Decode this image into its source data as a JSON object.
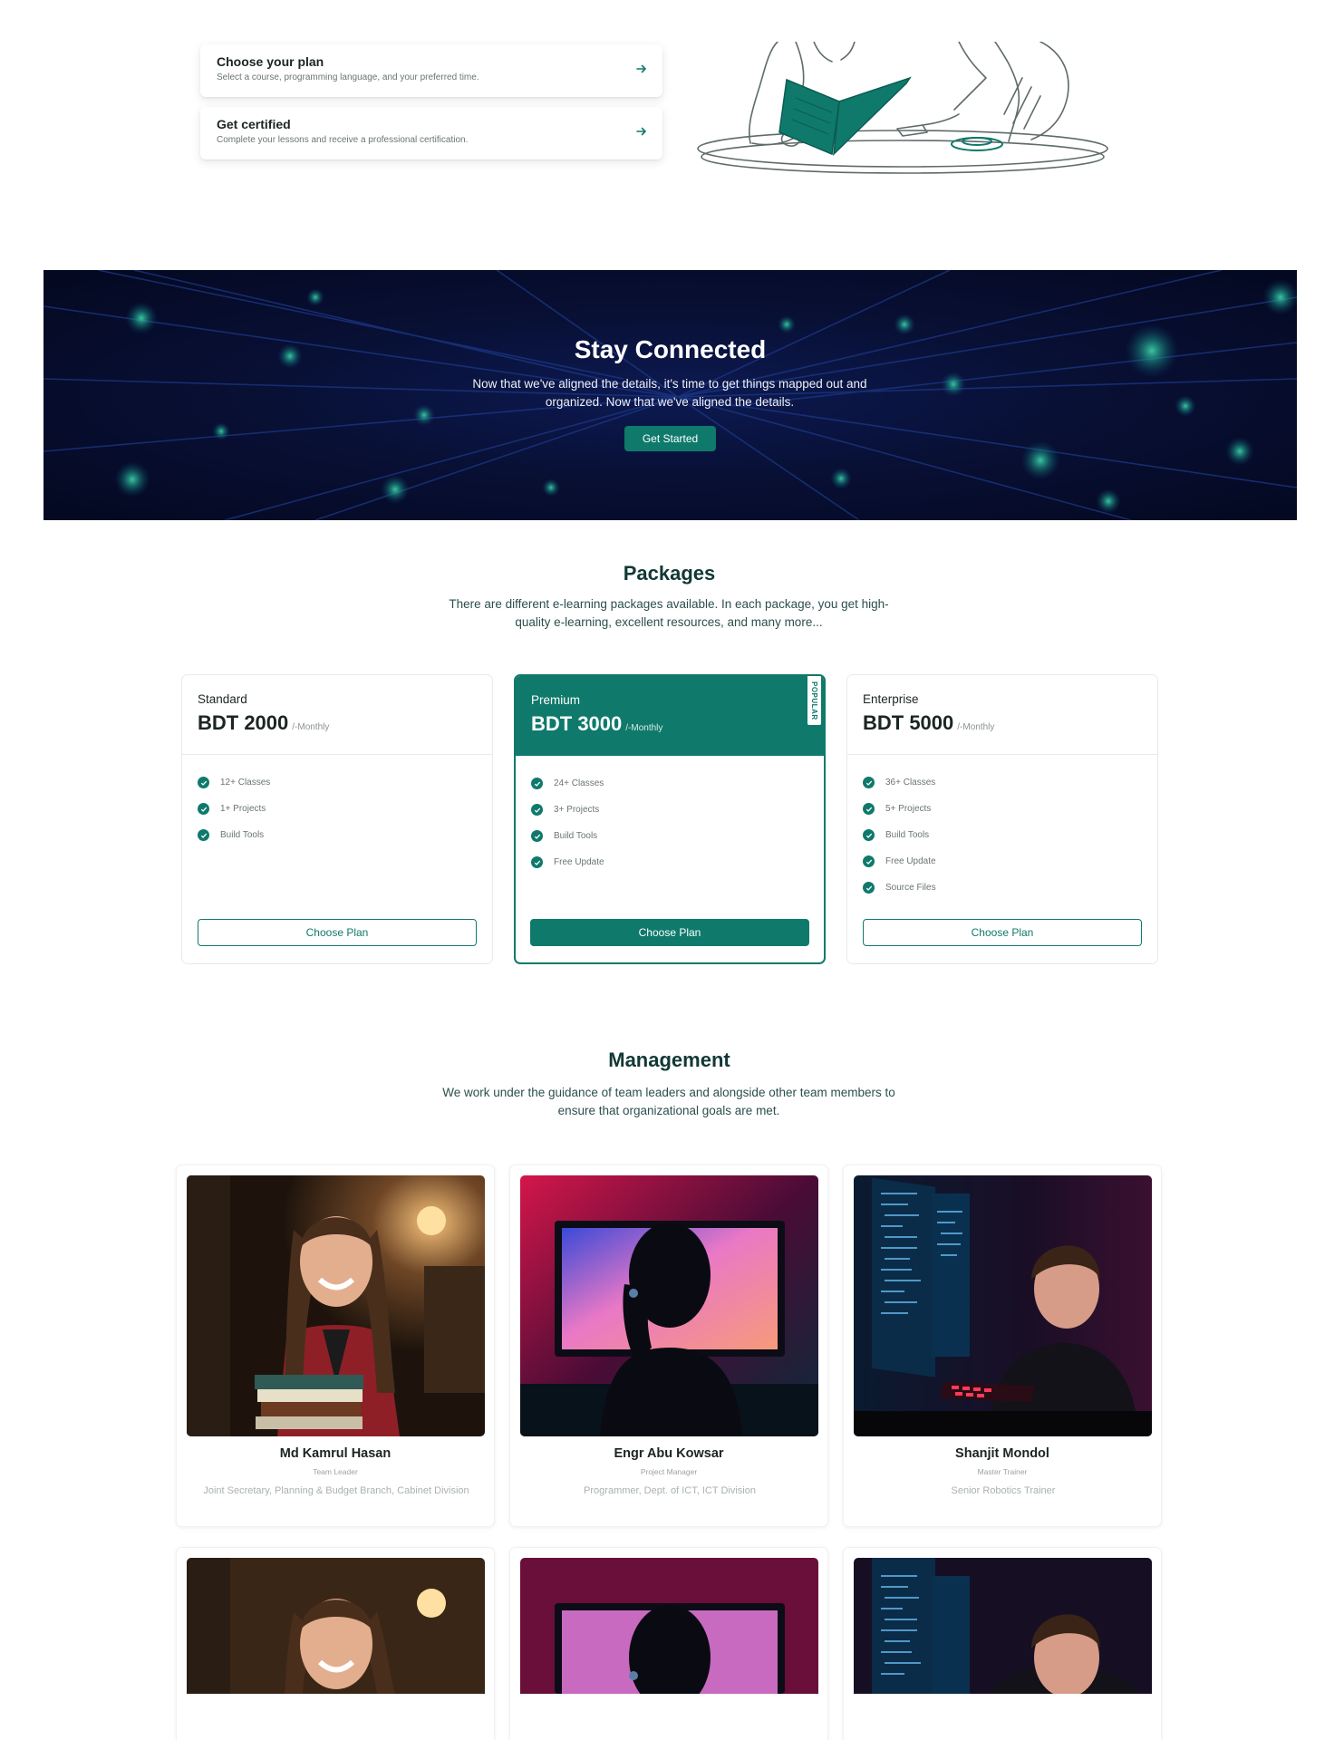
{
  "steps": [
    {
      "title": "Choose your plan",
      "desc": "Select a course, programming language, and your preferred time."
    },
    {
      "title": "Get certified",
      "desc": "Complete your lessons and receive a professional certification."
    }
  ],
  "hero": {
    "title": "Stay Connected",
    "text": "Now that we've aligned the details, it's time to get things mapped out and organized. Now that we've aligned the details.",
    "button": "Get Started"
  },
  "packages": {
    "title": "Packages",
    "subtitle": "There are different e-learning packages available. In each package, you get high-quality e-learning, excellent resources, and many more...",
    "popular_label": "POPULAR",
    "plans": [
      {
        "name": "Standard",
        "price": "BDT 2000",
        "period": "/-Monthly",
        "features": [
          "12+ Classes",
          "1+ Projects",
          "Build Tools"
        ],
        "button": "Choose Plan"
      },
      {
        "name": "Premium",
        "price": "BDT 3000",
        "period": "/-Monthly",
        "features": [
          "24+ Classes",
          "3+ Projects",
          "Build Tools",
          "Free Update"
        ],
        "button": "Choose Plan"
      },
      {
        "name": "Enterprise",
        "price": "BDT 5000",
        "period": "/-Monthly",
        "features": [
          "36+ Classes",
          "5+ Projects",
          "Build Tools",
          "Free Update",
          "Source Files"
        ],
        "button": "Choose Plan"
      }
    ]
  },
  "management": {
    "title": "Management",
    "subtitle": "We work under the guidance of team leaders and alongside other team members to ensure that organizational goals are met.",
    "members": [
      {
        "name": "Md Kamrul Hasan",
        "role": "Team Leader",
        "desc": "Joint Secretary, Planning & Budget Branch, Cabinet Division"
      },
      {
        "name": "Engr Abu Kowsar",
        "role": "Project Manager",
        "desc": "Programmer, Dept. of ICT, ICT Division"
      },
      {
        "name": "Shanjit Mondol",
        "role": "Master Trainer",
        "desc": "Senior Robotics Trainer"
      }
    ]
  },
  "colors": {
    "accent": "#0f7a6b",
    "heading": "#123836",
    "hero_bg": "#081035"
  }
}
